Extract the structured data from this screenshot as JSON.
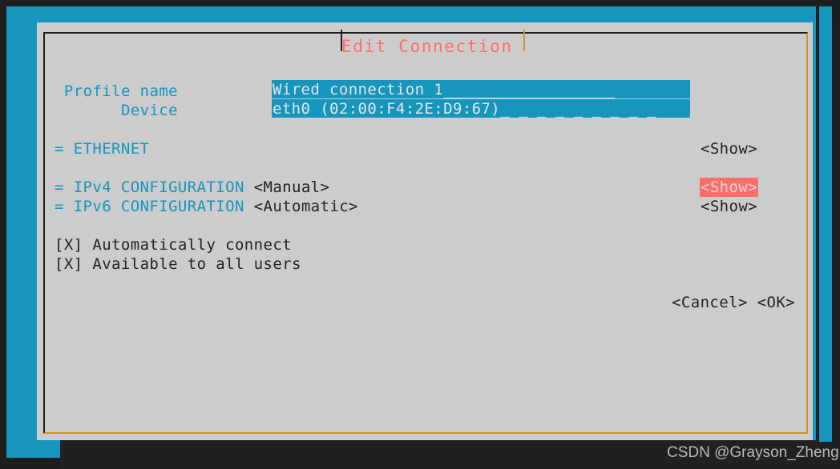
{
  "window": {
    "title": "Edit Connection",
    "title_color": "#ff6d6a",
    "dialog_bg": "#cccccc",
    "desktop_bg": "#1695bd",
    "terminal_bg": "#1e1e1e"
  },
  "fields": [
    {
      "label": "Profile name",
      "value": "Wired connection 1",
      "fill": "___________________",
      "fill_style": "solid"
    },
    {
      "label": "Device",
      "value": "eth0 (02:00:F4:2E:D9:67)",
      "fill": "_ _ _ _ _ _ _ _ _",
      "fill_style": "dashed"
    }
  ],
  "sections": [
    {
      "marker": "=",
      "name": "ETHERNET",
      "value": "",
      "action": "<Show>",
      "selected": false
    },
    {
      "marker": "=",
      "name": "IPv4 CONFIGURATION",
      "value": "<Manual>",
      "action": "<Show>",
      "selected": true
    },
    {
      "marker": "=",
      "name": "IPv6 CONFIGURATION",
      "value": "<Automatic>",
      "action": "<Show>",
      "selected": false
    }
  ],
  "checkboxes": [
    {
      "mark": "[X]",
      "label": "Automatically connect",
      "checked": true
    },
    {
      "mark": "[X]",
      "label": "Available to all users",
      "checked": true
    }
  ],
  "buttons": {
    "cancel": "<Cancel>",
    "ok": "<OK>"
  },
  "watermark": {
    "text": "CSDN @Grayson_Zheng"
  },
  "colors": {
    "accent_cyan": "#1695bd",
    "highlight_salmon": "#ff6d6a",
    "text_dark": "#26221e",
    "field_text": "#e6e6e6"
  }
}
